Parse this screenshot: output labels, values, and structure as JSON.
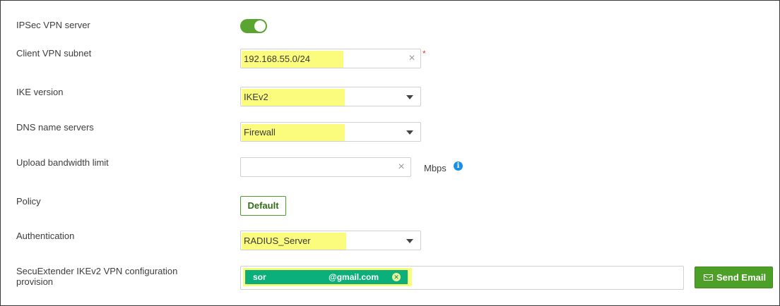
{
  "form": {
    "ipsec": {
      "label": "IPSec VPN server",
      "enabled": true
    },
    "subnet": {
      "label": "Client VPN subnet",
      "value": "192.168.55.0/24",
      "required_mark": "*"
    },
    "ike": {
      "label": "IKE version",
      "value": "IKEv2"
    },
    "dns": {
      "label": "DNS name servers",
      "value": "Firewall"
    },
    "bandwidth": {
      "label": "Upload bandwidth limit",
      "value": "",
      "unit": "Mbps"
    },
    "policy": {
      "label": "Policy",
      "button": "Default"
    },
    "auth": {
      "label": "Authentication",
      "value": "RADIUS_Server"
    },
    "provision": {
      "label": "SecuExtender IKEv2 VPN configuration provision",
      "email_local": "sor",
      "email_domain": "@gmail.com",
      "send_button": "Send Email"
    }
  },
  "colors": {
    "toggle_on": "#5aa531",
    "highlight": "#fbfb7e",
    "chip": "#0aaf7a",
    "send_button": "#4c9f27",
    "required": "#e0393e",
    "info": "#1a8fe3"
  },
  "icons": {
    "clear": "close-icon",
    "dropdown": "caret-down-icon",
    "info": "info-icon",
    "mail": "mail-icon"
  }
}
